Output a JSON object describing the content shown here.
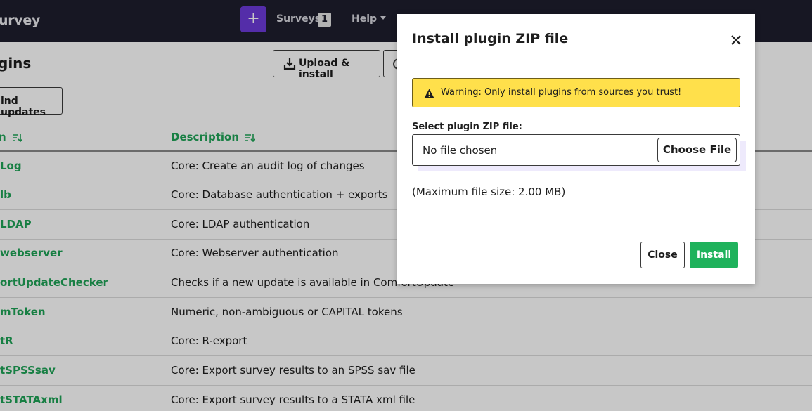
{
  "navbar": {
    "brand": "urvey",
    "plus": "+",
    "surveys_label": "Surveys",
    "surveys_count": "1",
    "help_label": "Help"
  },
  "page": {
    "title": "gins",
    "upload_install_label": "Upload & install",
    "find_updates_label": "ind updates"
  },
  "table": {
    "columns": [
      {
        "label": "n",
        "sort_icon": "sort-icon"
      },
      {
        "label": "Description",
        "sort_icon": "sort-icon"
      }
    ],
    "rows": [
      {
        "name": "Log",
        "description": "Core: Create an audit log of changes"
      },
      {
        "name": "lb",
        "description": "Core: Database authentication + exports"
      },
      {
        "name": "LDAP",
        "description": "Core: LDAP authentication"
      },
      {
        "name": "webserver",
        "description": "Core: Webserver authentication"
      },
      {
        "name": "ortUpdateChecker",
        "description": "Checks if a new update is available in ComfortUpdate"
      },
      {
        "name": "mToken",
        "description": "Numeric, non-ambiguous or CAPITAL tokens"
      },
      {
        "name": "tR",
        "description": "Core: R-export"
      },
      {
        "name": "tSPSSsav",
        "description": "Core: Export survey results to an SPSS sav file"
      },
      {
        "name": "tSTATAxml",
        "description": "Core: Export survey results to a STATA xml file"
      }
    ]
  },
  "modal": {
    "title": "Install plugin ZIP file",
    "close_icon": "close-icon",
    "warning_text": "Warning: Only install plugins from sources you trust!",
    "field_label": "Select plugin ZIP file:",
    "file_status": "No file chosen",
    "choose_file_label": "Choose File",
    "max_size_text": "(Maximum file size: 2.00 MB)",
    "close_button_label": "Close",
    "install_button_label": "Install"
  },
  "colors": {
    "navbar_bg": "#1e1e2d",
    "accent_purple": "#6c3ad9",
    "link_green": "#1ea356",
    "install_green": "#1fb25c",
    "warning_yellow": "#ffe04b"
  }
}
